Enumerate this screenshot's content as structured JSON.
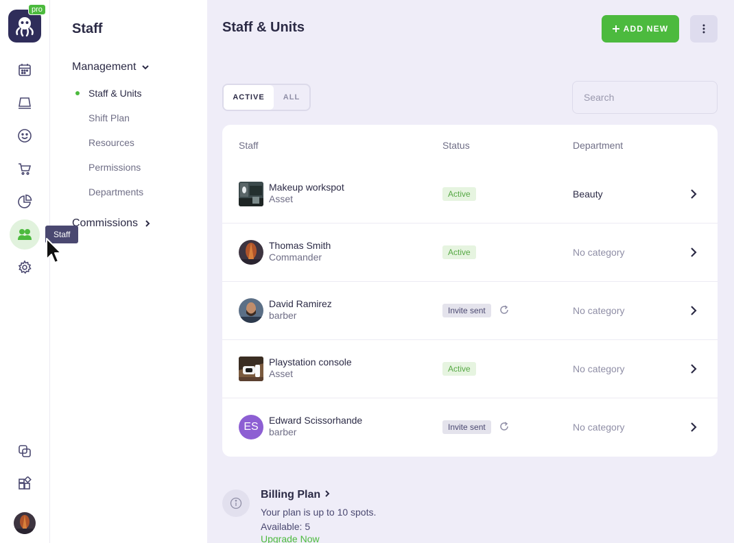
{
  "app": {
    "badge": "pro",
    "colors": {
      "accent": "#4cba3e",
      "dark": "#2b2a45",
      "tooltip": "#4a4870"
    }
  },
  "rail": {
    "items": [
      {
        "icon": "calendar-icon"
      },
      {
        "icon": "desk-icon"
      },
      {
        "icon": "smiley-icon"
      },
      {
        "icon": "cart-icon"
      },
      {
        "icon": "pie-chart-icon"
      },
      {
        "icon": "staff-icon",
        "active": true
      },
      {
        "icon": "gear-icon"
      }
    ],
    "bottom": [
      {
        "icon": "copy-icon"
      },
      {
        "icon": "widgets-icon"
      }
    ],
    "tooltip": "Staff"
  },
  "sidenav": {
    "title": "Staff",
    "management": {
      "label": "Management",
      "items": [
        "Staff & Units",
        "Shift Plan",
        "Resources",
        "Permissions",
        "Departments"
      ]
    },
    "commissions": {
      "label": "Commissions"
    }
  },
  "header": {
    "title": "Staff & Units",
    "add_label": "ADD NEW"
  },
  "filter": {
    "active": "ACTIVE",
    "all": "ALL"
  },
  "search": {
    "placeholder": "Search",
    "value": ""
  },
  "table": {
    "columns": {
      "staff": "Staff",
      "status": "Status",
      "department": "Department"
    },
    "rows": [
      {
        "name": "Makeup workspot",
        "role": "Asset",
        "status": "Active",
        "department": "Beauty"
      },
      {
        "name": "Thomas Smith",
        "role": "Commander",
        "status": "Active",
        "department": "No category"
      },
      {
        "name": "David Ramirez",
        "role": "barber",
        "status": "Invite sent",
        "department": "No category"
      },
      {
        "name": "Playstation console",
        "role": "Asset",
        "status": "Active",
        "department": "No category"
      },
      {
        "name": "Edward Scissorhande",
        "role": "barber",
        "status": "Invite sent",
        "department": "No category",
        "initials": "ES"
      }
    ]
  },
  "billing": {
    "title": "Billing Plan",
    "line1": "Your plan is up to 10 spots.",
    "line2": "Available: 5",
    "upgrade": "Upgrade Now"
  }
}
